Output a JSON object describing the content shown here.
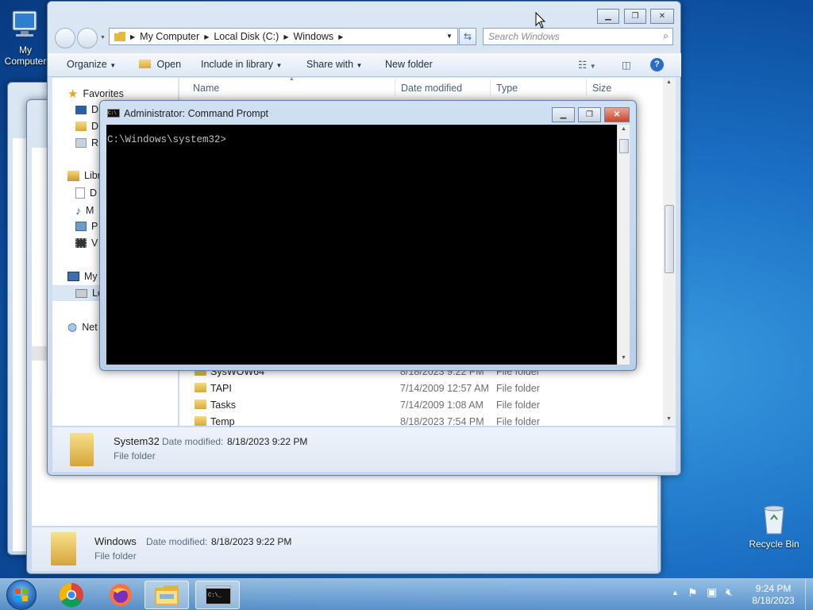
{
  "desktop": {
    "icons": [
      {
        "label": "My Computer",
        "icon": "my-computer-icon"
      },
      {
        "label": "Recycle Bin",
        "icon": "recycle-bin-icon"
      }
    ]
  },
  "explorer_back": {
    "details": {
      "name": "Windows",
      "modified_label": "Date modified:",
      "modified_value": "8/18/2023 9:22 PM",
      "type": "File folder"
    }
  },
  "explorer": {
    "breadcrumb": [
      "My Computer",
      "Local Disk (C:)",
      "Windows"
    ],
    "search_placeholder": "Search Windows",
    "toolbar": {
      "organize": "Organize",
      "open": "Open",
      "include_in_library": "Include in library",
      "share_with": "Share with",
      "new_folder": "New folder"
    },
    "columns": {
      "name": "Name",
      "date_modified": "Date modified",
      "type": "Type",
      "size": "Size"
    },
    "nav": {
      "favorites": "Favorites",
      "fav_items": [
        "D",
        "D",
        "R"
      ],
      "libraries": "Libr",
      "lib_items": [
        "D",
        "M",
        "P",
        "V"
      ],
      "computer": "My",
      "local_disk": "Lo",
      "network": "Net"
    },
    "files": [
      {
        "name": "SysWOW64",
        "date": "8/18/2023 9:22 PM",
        "type": "File folder"
      },
      {
        "name": "TAPI",
        "date": "7/14/2009 12:57 AM",
        "type": "File folder"
      },
      {
        "name": "Tasks",
        "date": "7/14/2009 1:08 AM",
        "type": "File folder"
      },
      {
        "name": "Temp",
        "date": "8/18/2023 7:54 PM",
        "type": "File folder"
      }
    ],
    "details": {
      "name": "System32",
      "modified_label": "Date modified:",
      "modified_value": "8/18/2023 9:22 PM",
      "type": "File folder"
    }
  },
  "cmd": {
    "title": "Administrator:  Command Prompt",
    "prompt": "C:\\Windows\\system32>"
  },
  "taskbar": {
    "apps": [
      "start-orb-icon",
      "chrome-icon",
      "firefox-icon",
      "explorer-icon",
      "cmd-icon"
    ],
    "time": "9:24 PM",
    "date": "8/18/2023"
  }
}
